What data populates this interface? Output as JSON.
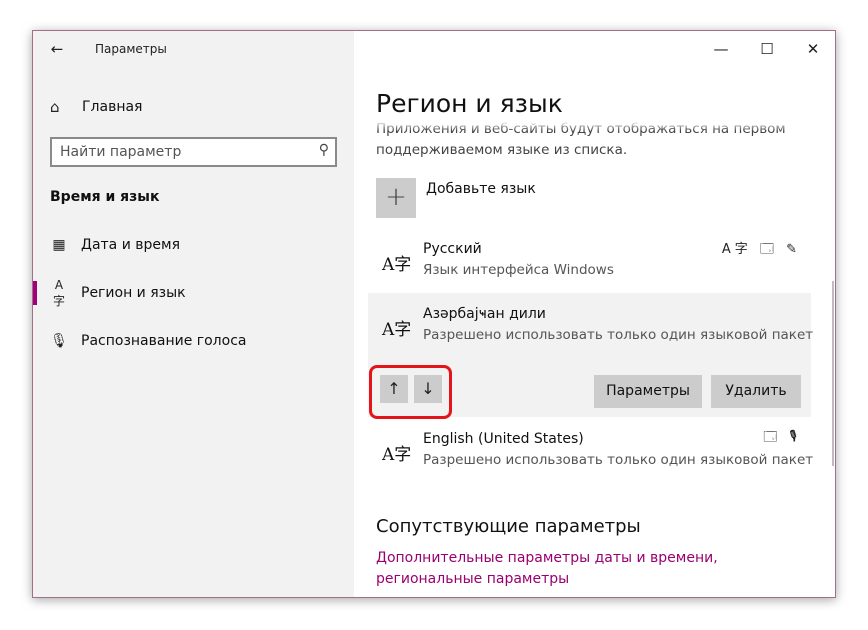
{
  "window": {
    "title": "Параметры",
    "back_icon": "arrow-left-icon",
    "controls": {
      "minimize": "—",
      "maximize": "☐",
      "close": "✕"
    }
  },
  "sidebar": {
    "home": {
      "label": "Главная",
      "icon": "home-icon"
    },
    "search": {
      "placeholder": "Найти параметр",
      "value": "",
      "icon": "search-icon"
    },
    "section_title": "Время и язык",
    "items": [
      {
        "label": "Дата и время",
        "icon": "calendar-clock-icon",
        "active": false
      },
      {
        "label": "Регион и язык",
        "icon": "language-icon",
        "active": true
      },
      {
        "label": "Распознавание голоса",
        "icon": "microphone-icon",
        "active": false
      }
    ]
  },
  "main": {
    "title": "Регион и язык",
    "intro": "Приложения и веб-сайты будут отображаться на первом поддерживаемом языке из списка.",
    "add_language": {
      "label": "Добавьте язык",
      "icon": "plus-icon"
    },
    "languages": [
      {
        "name": "Русский",
        "desc": "Язык интерфейса Windows",
        "icon": "language-icon",
        "features": "A字 🗔 ✎"
      },
      {
        "name": "Азәрбајҹан дили",
        "desc": "Разрешено использовать только один языковой пакет",
        "icon": "language-icon",
        "selected": true
      },
      {
        "name": "English (United States)",
        "desc": "Разрешено использовать только один языковой пакет",
        "icon": "language-icon",
        "features": "🗔 🎙"
      }
    ],
    "move_up": "↑",
    "move_down": "↓",
    "options_button": "Параметры",
    "remove_button": "Удалить",
    "related_title": "Сопутствующие параметры",
    "related_link": "Дополнительные параметры даты и времени, региональные параметры"
  },
  "colors": {
    "accent": "#a0007a",
    "highlight": "#e4141b",
    "sidebar_bg": "#f2f2f2",
    "button_bg": "#cccccc"
  }
}
